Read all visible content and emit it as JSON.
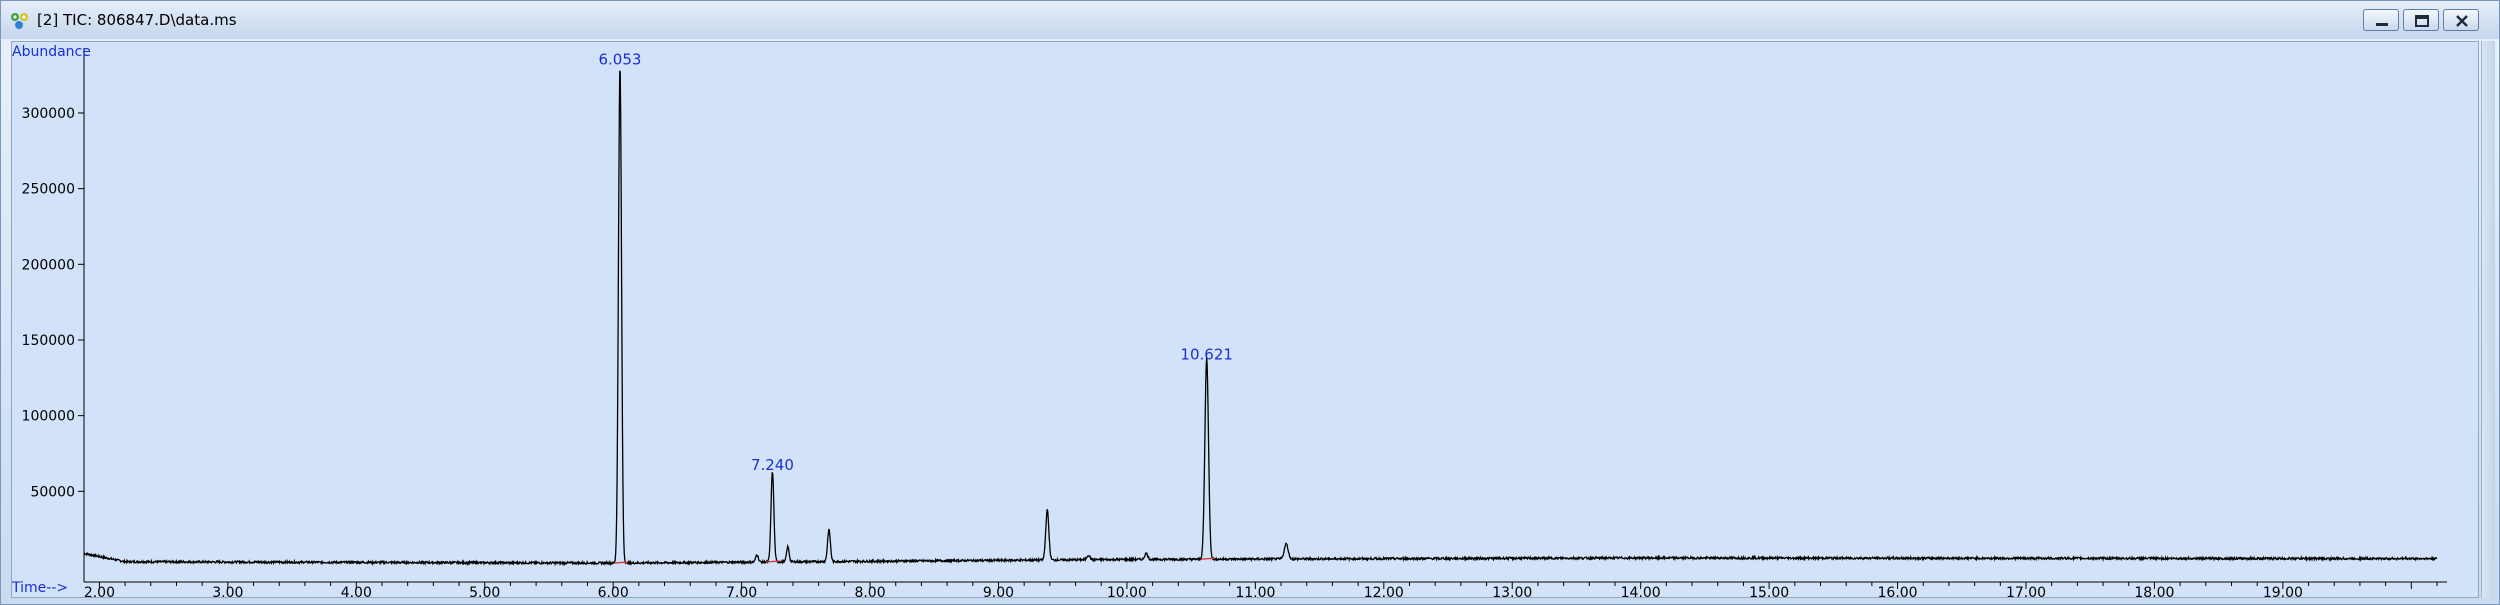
{
  "window": {
    "title": "[2] TIC: 806847.D\\data.ms",
    "controls": {
      "minimize": "minimize-icon",
      "restore": "restore-icon",
      "close": "close-icon"
    }
  },
  "colors": {
    "plot_background": "#d2e2f8",
    "trace": "#000000",
    "label_blue": "#1a2fd6",
    "integration_mark": "#d43b3b"
  },
  "chart_data": {
    "type": "line",
    "ylabel": "Abundance",
    "xlabel": "Time-->",
    "xlim": [
      1.88,
      20.2
    ],
    "ylim": [
      0,
      335000
    ],
    "x_ticks": [
      2.0,
      3.0,
      4.0,
      5.0,
      6.0,
      7.0,
      8.0,
      9.0,
      10.0,
      11.0,
      12.0,
      13.0,
      14.0,
      15.0,
      16.0,
      17.0,
      18.0,
      19.0
    ],
    "x_tick_labels": [
      "2.00",
      "3.00",
      "4.00",
      "5.00",
      "6.00",
      "7.00",
      "8.00",
      "9.00",
      "10.00",
      "11.00",
      "12.00",
      "13.00",
      "14.00",
      "15.00",
      "16.00",
      "17.00",
      "18.00",
      "19.00"
    ],
    "y_ticks": [
      50000,
      100000,
      150000,
      200000,
      250000,
      300000
    ],
    "y_tick_labels": [
      "50000",
      "100000",
      "150000",
      "200000",
      "250000",
      "300000"
    ],
    "baseline": [
      [
        1.88,
        9000
      ],
      [
        2.2,
        3500
      ],
      [
        6.0,
        2600
      ],
      [
        10.0,
        5000
      ],
      [
        14.0,
        6000
      ],
      [
        20.2,
        5500
      ]
    ],
    "peaks": [
      {
        "rt": 6.053,
        "height": 328000,
        "width": 0.012
      },
      {
        "rt": 7.12,
        "height": 5000,
        "width": 0.01
      },
      {
        "rt": 7.24,
        "height": 60000,
        "width": 0.011
      },
      {
        "rt": 7.36,
        "height": 10000,
        "width": 0.01
      },
      {
        "rt": 7.68,
        "height": 21000,
        "width": 0.011
      },
      {
        "rt": 9.38,
        "height": 33000,
        "width": 0.012
      },
      {
        "rt": 9.7,
        "height": 3000,
        "width": 0.012
      },
      {
        "rt": 10.15,
        "height": 4000,
        "width": 0.012
      },
      {
        "rt": 10.621,
        "height": 133000,
        "width": 0.014
      },
      {
        "rt": 11.24,
        "height": 10000,
        "width": 0.015
      }
    ],
    "peak_labels": [
      {
        "rt": 6.053,
        "abundance": 328000,
        "text": "6.053"
      },
      {
        "rt": 7.24,
        "abundance": 60000,
        "text": "7.240"
      },
      {
        "rt": 10.621,
        "abundance": 133000,
        "text": "10.621"
      }
    ],
    "grid": false
  }
}
